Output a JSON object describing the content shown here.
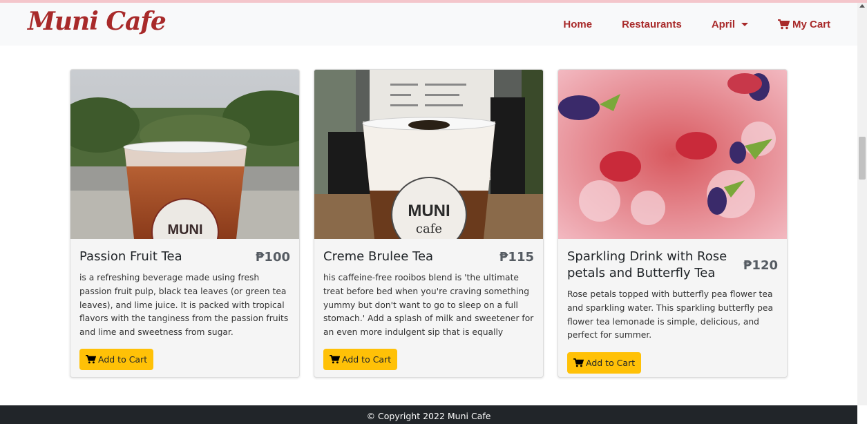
{
  "brand": "Muni Cafe",
  "nav": {
    "home": "Home",
    "restaurants": "Restaurants",
    "user": "April",
    "cart": "My Cart"
  },
  "products": [
    {
      "name": "Passion Fruit Tea",
      "price": "₱100",
      "description": "is a refreshing beverage made using fresh passion fruit pulp, black tea leaves (or green tea leaves), and lime juice. It is packed with tropical flavors with the tanginess from the passion fruits and lime and sweetness from sugar.",
      "button": "Add to Cart",
      "image_icon": "iced-tea-photo"
    },
    {
      "name": "Creme Brulee Tea",
      "price": "₱115",
      "description": "his caffeine-free rooibos blend is 'the ultimate treat before bed when you're craving something yummy but don't want to go to sleep on a full stomach.' Add a splash of milk and sweetener for an even more indulgent sip that is equally delicious hot as it i",
      "button": "Add to Cart",
      "image_icon": "milk-tea-photo"
    },
    {
      "name": "Sparkling Drink with Rose petals and Butterfly Tea",
      "price": "₱120",
      "description": "Rose petals topped with butterfly pea flower tea and sparkling water. This sparkling butterfly pea flower tea lemonade is simple, delicious, and perfect for summer.",
      "button": "Add to Cart",
      "image_icon": "sparkling-drink-photo"
    }
  ],
  "footer": "© Copyright 2022 Muni Cafe",
  "cup_label": {
    "line1": "MUNI",
    "line2": "cafe"
  },
  "colors": {
    "brand": "#a82a2a",
    "button": "#ffc107",
    "footer_bg": "#212529",
    "nav_bg": "#f8f9fa"
  }
}
